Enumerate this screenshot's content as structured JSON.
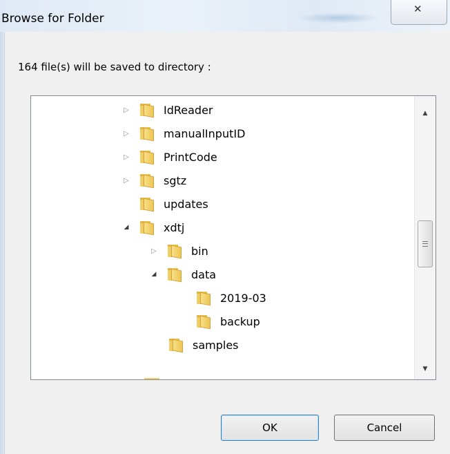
{
  "window": {
    "title": "Browse for Folder",
    "close_glyph": "✕"
  },
  "message": "164 file(s) will be saved to directory :",
  "tree": {
    "items": [
      {
        "label": "IdReader",
        "expander": "collapsed"
      },
      {
        "label": "manualInputID",
        "expander": "collapsed"
      },
      {
        "label": "PrintCode",
        "expander": "collapsed"
      },
      {
        "label": "sgtz",
        "expander": "collapsed"
      },
      {
        "label": "updates",
        "expander": "none"
      },
      {
        "label": "xdtj",
        "expander": "expanded"
      },
      {
        "label": "bin",
        "expander": "collapsed"
      },
      {
        "label": "data",
        "expander": "expanded"
      },
      {
        "label": "2019-03",
        "expander": "none"
      },
      {
        "label": "backup",
        "expander": "none"
      },
      {
        "label": "samples",
        "expander": "none"
      }
    ],
    "icon": "folder-icon"
  },
  "buttons": {
    "ok": "OK",
    "cancel": "Cancel"
  },
  "colors": {
    "titlebar": "#dfe9f5",
    "folder": "#eec552",
    "ok_border": "#3c7fb1"
  }
}
